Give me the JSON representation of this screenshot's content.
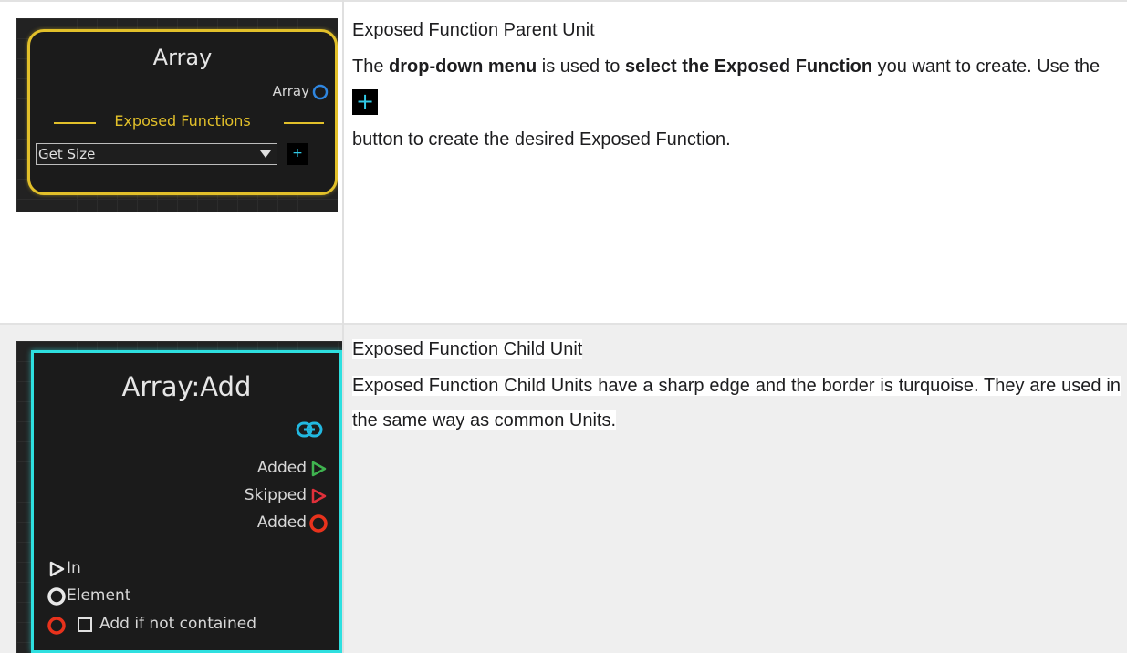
{
  "rows": [
    {
      "title": "Exposed Function Parent Unit",
      "body_pre": "The ",
      "body_bold1": "drop-down menu",
      "body_mid": " is used to ",
      "body_bold2": "select the Exposed Function",
      "body_post": " you want to create. Use the",
      "button_glyph": "+",
      "body_after_button": "button to create the desired Exposed Function.",
      "node": {
        "title": "Array",
        "output_label": "Array",
        "section_label": "Exposed Functions",
        "dropdown_value": "Get Size",
        "add_glyph": "+"
      }
    },
    {
      "title": "Exposed Function Child Unit",
      "body": "Exposed Function Child Units have a sharp edge and the border is turquoise. They are used in the same way as common Units.",
      "node": {
        "title": "Array:Add",
        "outputs": [
          "Added",
          "Skipped",
          "Added"
        ],
        "inputs": [
          "In",
          "Element"
        ],
        "checkbox_label": "Add if not contained"
      }
    }
  ],
  "colors": {
    "parent_border": "#e2c02a",
    "child_border": "#2ee0e0",
    "flow_green": "#3fb34f",
    "flow_red": "#e0303a",
    "port_blue": "#2f86e0",
    "port_red": "#e8321c",
    "plus_cyan": "#31c9e6"
  }
}
